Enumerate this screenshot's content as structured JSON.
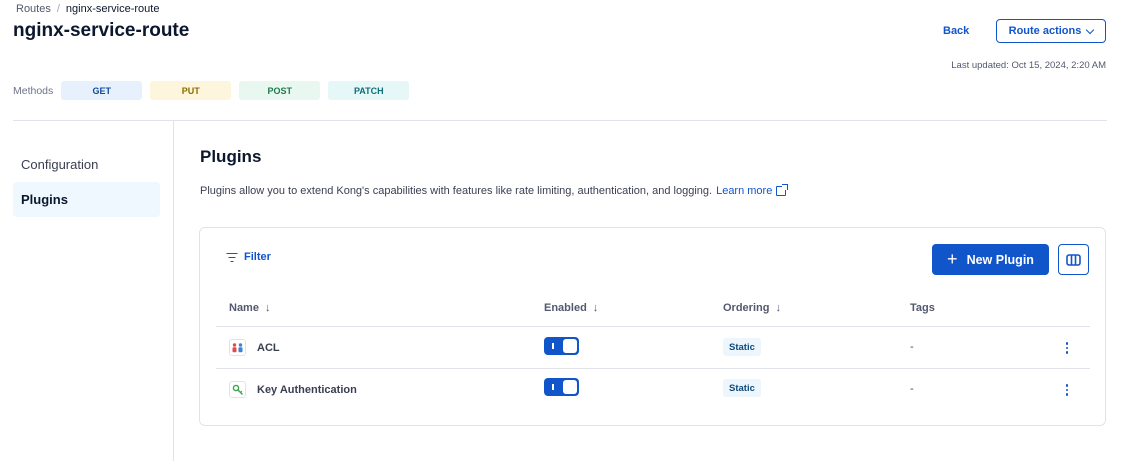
{
  "breadcrumb": {
    "parent": "Routes",
    "separator": "/",
    "current": "nginx-service-route"
  },
  "page": {
    "title": "nginx-service-route",
    "last_updated": "Last updated: Oct 15, 2024, 2:20 AM"
  },
  "header_actions": {
    "back_label": "Back",
    "route_actions_label": "Route actions"
  },
  "methods": {
    "label": "Methods",
    "items": [
      {
        "label": "GET",
        "bg": "#e7f1fd",
        "fg": "#0e4a9e"
      },
      {
        "label": "PUT",
        "bg": "#fdf6dc",
        "fg": "#8a6d00"
      },
      {
        "label": "POST",
        "bg": "#e8f8f1",
        "fg": "#1f7a4d"
      },
      {
        "label": "PATCH",
        "bg": "#e6f7f8",
        "fg": "#0f6e78"
      }
    ]
  },
  "sidebar": {
    "items": [
      {
        "label": "Configuration",
        "active": false
      },
      {
        "label": "Plugins",
        "active": true
      }
    ]
  },
  "plugins_section": {
    "title": "Plugins",
    "description": "Plugins allow you to extend Kong's capabilities with features like rate limiting, authentication, and logging.",
    "learn_more": "Learn more"
  },
  "toolbar": {
    "filter_label": "Filter",
    "new_plugin_label": "New Plugin"
  },
  "table": {
    "columns": [
      {
        "label": "Name"
      },
      {
        "label": "Enabled"
      },
      {
        "label": "Ordering"
      },
      {
        "label": "Tags"
      }
    ],
    "rows": [
      {
        "name": "ACL",
        "icon": "acl-icon",
        "enabled": true,
        "ordering": "Static",
        "tags": "-"
      },
      {
        "name": "Key Authentication",
        "icon": "key-auth-icon",
        "enabled": true,
        "ordering": "Static",
        "tags": "-"
      }
    ]
  },
  "colors": {
    "accent": "#1155cb",
    "text": "#0b172d",
    "muted": "#52596e",
    "border": "#e0e4ea"
  }
}
